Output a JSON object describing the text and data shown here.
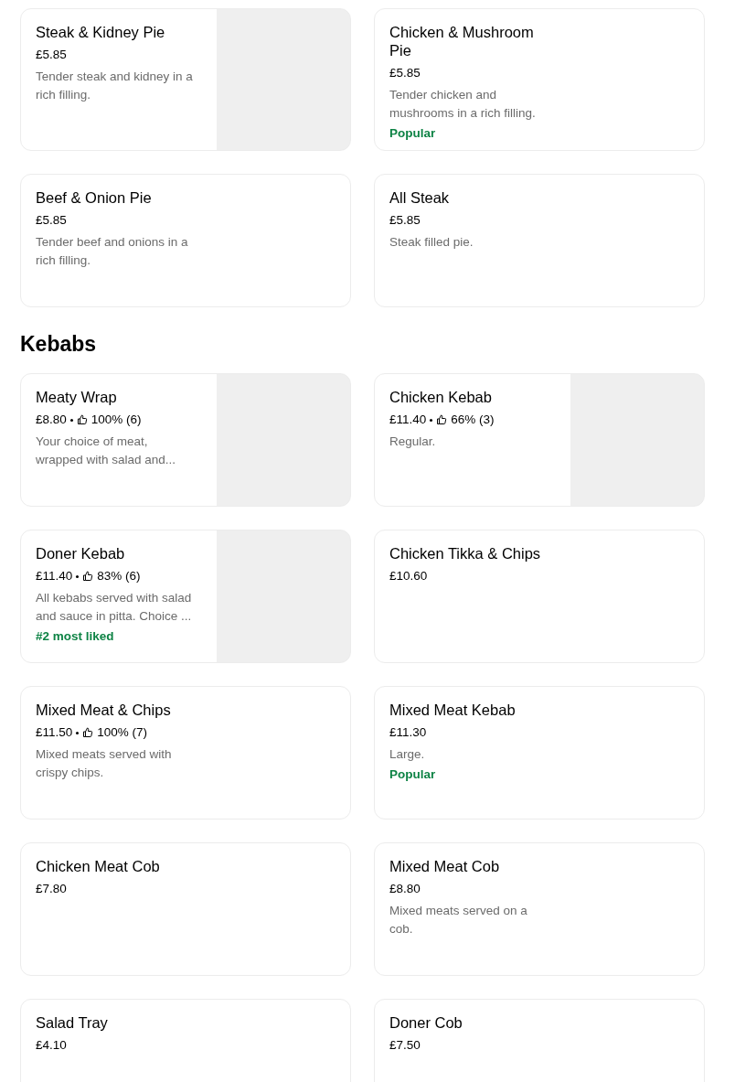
{
  "sections": [
    {
      "items": [
        {
          "name": "Steak & Kidney Pie",
          "price": "£5.85",
          "description": "Tender steak and kidney in a rich filling.",
          "has_image": true
        },
        {
          "name": "Chicken & Mushroom Pie",
          "price": "£5.85",
          "description": "Tender chicken and mushrooms in a rich filling.",
          "tag": "Popular",
          "has_image": false
        },
        {
          "name": "Beef & Onion Pie",
          "price": "£5.85",
          "description": "Tender beef and onions in a rich filling.",
          "has_image": false
        },
        {
          "name": "All Steak",
          "price": "£5.85",
          "description": "Steak filled pie.",
          "has_image": false
        }
      ]
    },
    {
      "title": "Kebabs",
      "items": [
        {
          "name": "Meaty Wrap",
          "price": "£8.80",
          "rating": "100% (6)",
          "description": "Your choice of meat, wrapped with salad and...",
          "has_image": true
        },
        {
          "name": "Chicken Kebab",
          "price": "£11.40",
          "rating": "66% (3)",
          "description": "Regular.",
          "has_image": true
        },
        {
          "name": "Doner Kebab",
          "price": "£11.40",
          "rating": "83% (6)",
          "description": "All kebabs served with salad and sauce in pitta. Choice ...",
          "tag": "#2 most liked",
          "has_image": true
        },
        {
          "name": "Chicken Tikka & Chips",
          "price": "£10.60",
          "has_image": false
        },
        {
          "name": "Mixed Meat & Chips",
          "price": "£11.50",
          "rating": "100% (7)",
          "description": "Mixed meats served with crispy chips.",
          "has_image": false
        },
        {
          "name": "Mixed Meat Kebab",
          "price": "£11.30",
          "description": "Large.",
          "tag": "Popular",
          "has_image": false
        },
        {
          "name": "Chicken Meat Cob",
          "price": "£7.80",
          "has_image": false
        },
        {
          "name": "Mixed Meat Cob",
          "price": "£8.80",
          "description": "Mixed meats served on a cob.",
          "has_image": false
        },
        {
          "name": "Salad Tray",
          "price": "£4.10",
          "has_image": false
        },
        {
          "name": "Doner Cob",
          "price": "£7.50",
          "has_image": false
        }
      ]
    }
  ]
}
